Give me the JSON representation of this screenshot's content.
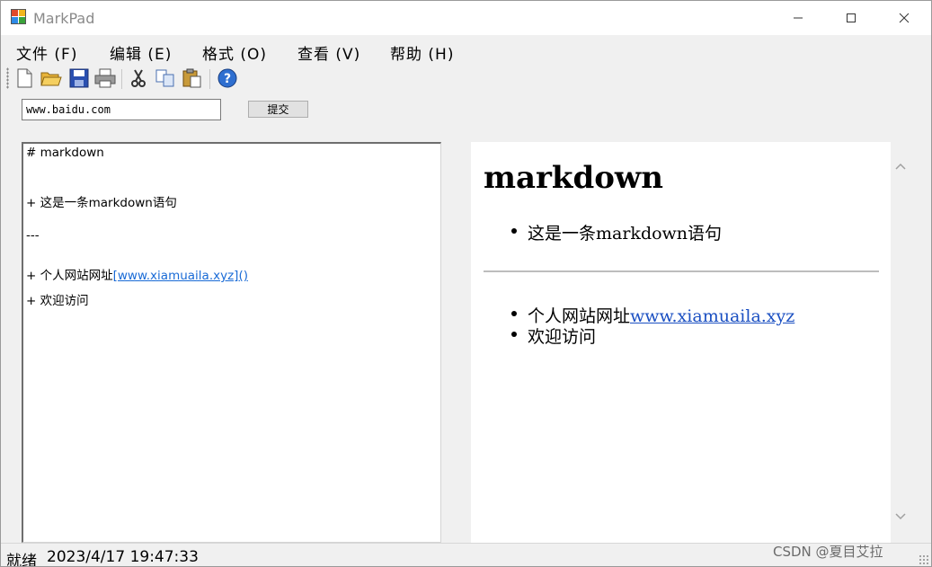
{
  "window": {
    "title": "MarkPad"
  },
  "menu": [
    {
      "label": "文件 (F)"
    },
    {
      "label": "编辑 (E)"
    },
    {
      "label": "格式 (O)"
    },
    {
      "label": "查看 (V)"
    },
    {
      "label": "帮助 (H)"
    }
  ],
  "toolbar": {
    "icons": [
      "new-file-icon",
      "open-folder-icon",
      "save-icon",
      "print-icon",
      "cut-icon",
      "copy-icon",
      "paste-icon",
      "help-icon"
    ]
  },
  "url_bar": {
    "value": "www.baidu.com",
    "submit_label": "提交"
  },
  "editor": {
    "lines": [
      {
        "text": "# markdown"
      },
      {
        "text": "+ 这是一条markdown语句"
      },
      {
        "text": "---"
      },
      {
        "prefix": "+ 个人网站网址",
        "link": "[www.xiamuaila.xyz]()"
      },
      {
        "text": "+ 欢迎访问"
      }
    ]
  },
  "preview": {
    "heading": "markdown",
    "list1": [
      "这是一条markdown语句"
    ],
    "list2_item1_prefix": "个人网站网址",
    "list2_item1_link": "www.xiamuaila.xyz",
    "list2_item2": "欢迎访问"
  },
  "statusbar": {
    "status": "就绪",
    "datetime": "2023/4/17 19:47:33"
  },
  "watermark": "CSDN @夏目艾拉",
  "colors": {
    "link": "#1a6bd6",
    "background": "#f0f0f0"
  }
}
